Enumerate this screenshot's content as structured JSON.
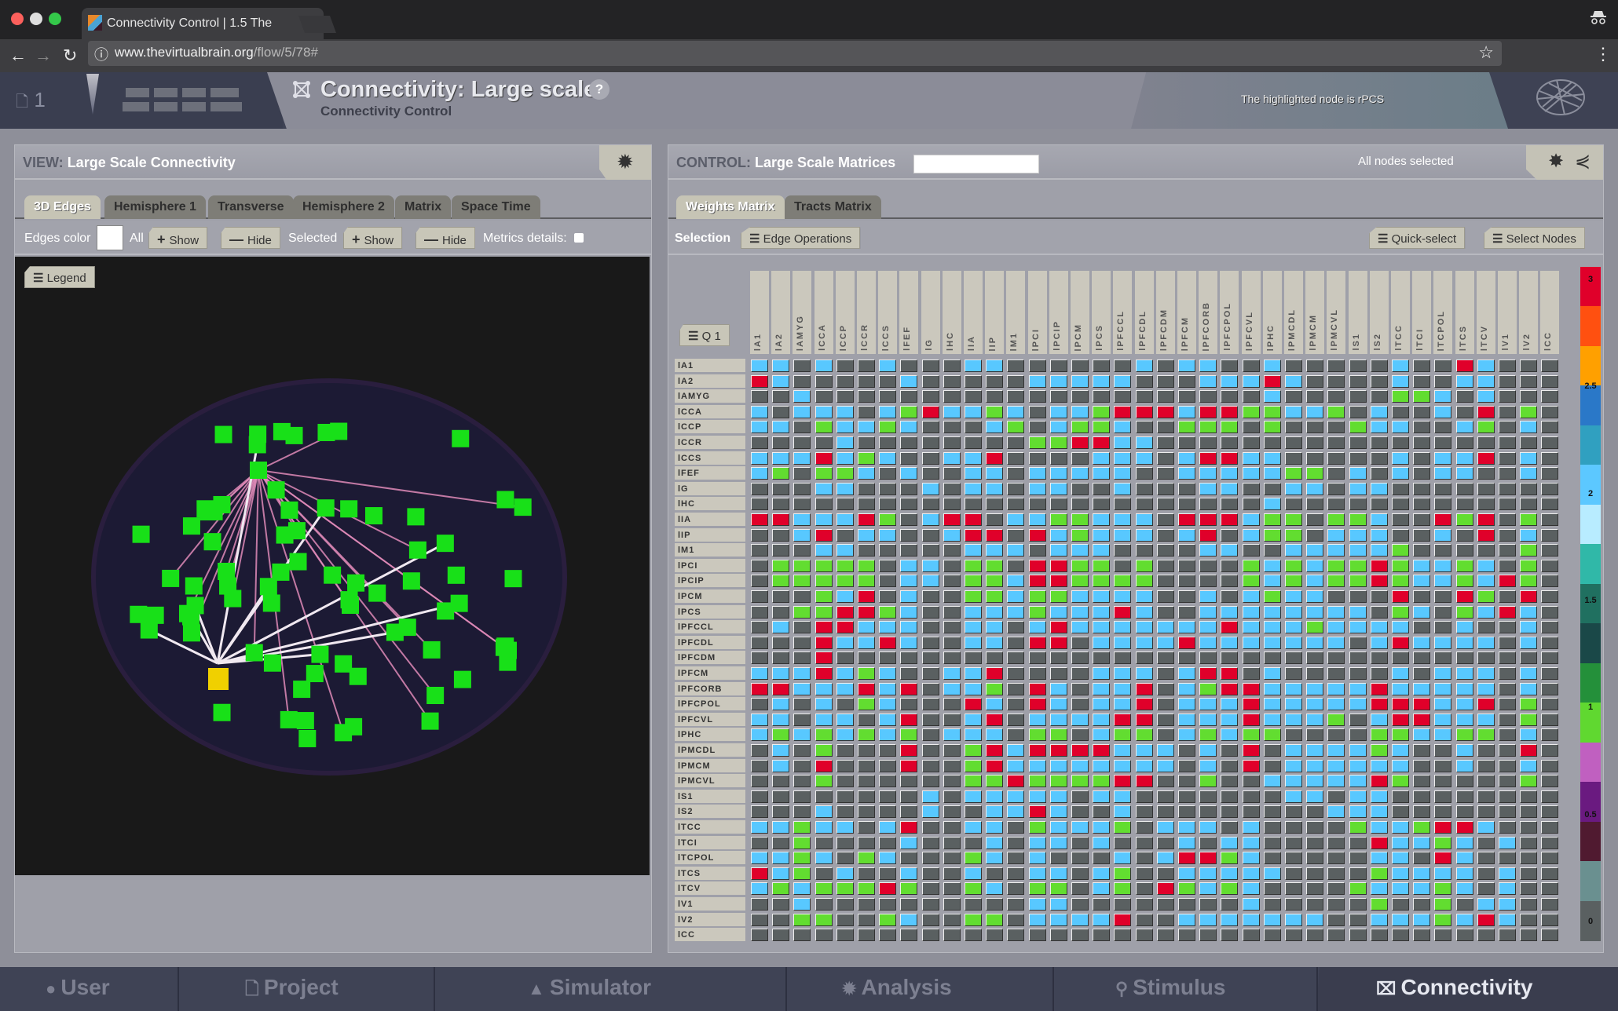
{
  "browser": {
    "tab_title": "Connectivity Control | 1.5 The",
    "tab_close": "×",
    "url_domain": "www.thevirtualbrain.org",
    "url_path": "/flow/5/78#",
    "back": "←",
    "forward": "→",
    "reload": "↻",
    "info": "ⓘ",
    "star": "☆",
    "menu": "⋮",
    "incognito": "🕶"
  },
  "header": {
    "project_count": "1",
    "title": "Connectivity: Large scale",
    "subtitle": "Connectivity Control",
    "help": "?",
    "message": "The highlighted node is rPCS"
  },
  "view_panel": {
    "title_prefix": "VIEW:",
    "title": "Large Scale Connectivity",
    "tabs": [
      "3D Edges",
      "Hemisphere 1",
      "Transverse",
      "Hemisphere 2",
      "Matrix",
      "Space Time"
    ],
    "active_tab": "3D Edges",
    "toolbar": {
      "edges_color_label": "Edges color",
      "edges_color": "#ffffff",
      "all_label": "All",
      "show": "Show",
      "hide": "Hide",
      "selected_label": "Selected",
      "metrics_label": "Metrics details:"
    },
    "legend_button": "Legend",
    "highlighted_node_color": "#f0d000",
    "node_color": "#18e018"
  },
  "control_panel": {
    "title_prefix": "CONTROL:",
    "title": "Large Scale Matrices",
    "search_value": "",
    "status": "All nodes selected",
    "tabs": [
      "Weights Matrix",
      "Tracts Matrix"
    ],
    "active_tab": "Weights Matrix",
    "selection_label": "Selection",
    "edge_operations": "Edge Operations",
    "quick_select": "Quick-select",
    "select_nodes": "Select Nodes",
    "quadrant_button": "Q 1"
  },
  "matrix": {
    "labels": [
      "lA1",
      "lA2",
      "lAMYG",
      "lCCA",
      "lCCP",
      "lCCR",
      "lCCS",
      "lFEF",
      "lG",
      "lHC",
      "lIA",
      "lIP",
      "lM1",
      "lPCI",
      "lPCIP",
      "lPCM",
      "lPCS",
      "lPFCCL",
      "lPFCDL",
      "lPFCDM",
      "lPFCM",
      "lPFCORB",
      "lPFCPOL",
      "lPFCVL",
      "lPHC",
      "lPMCDL",
      "lPMCM",
      "lPMCVL",
      "lS1",
      "lS2",
      "lTCC",
      "lTCI",
      "lTCPOL",
      "lTCS",
      "lTCV",
      "lV1",
      "lV2",
      "lCC"
    ],
    "legend": {
      "D": 0,
      "G": 1,
      "B": 2,
      "R": 3
    },
    "colors": {
      "D": "#5a6061",
      "G": "#62dd30",
      "B": "#58c8ff",
      "R": "#e0002a"
    },
    "rows": [
      "BBDBDDBDDDBBDDDDDDBDBBDDBDDDDDBDDRBDDD",
      "RBDDDDDBDDDDDBBBBBDDDBBBRBDDDDBDDBBDDD",
      "DDBDDDDDDDDDDDDDDDDDDDDDBDDDDDGGBDBDDD",
      "BDBBBDBGRBBGBDBBGRRRBRRGGBBGDBDDBDRDGD",
      "BBDGBBGBDDDBGDBGGBDDGGGDGDDDGBBDDBGDBD",
      "DDDDBDDDDDDDDGGRRBBDDDDDDDDDDDDDDDDDDD",
      "BBBRBGBDDBBRDDDDBBBDBRRBBDDDDDBDBBRDBD",
      "BGDGGBDBDDBBDBBBBBDDBBBBBGGDBDBDBBDDBD",
      "DDDBBDDDBDBBDBBDDBDDDBBDDBBDBBDDDDDDDD",
      "DDDDDDDDDDDDDDDDDDDDDDDDBDDDDDDDDDDDDD",
      "RRBBBRGDBRRDBBGGBBBDRRRBGGDGGBDDRGRDGD",
      "DDBRDBBDDBRRDRBGBBBDBRDBGGDBBBDDBDRDBD",
      "DDDBBDDDDDBBBDBBBDDDDBBDDBBBBBGDDDDDGD",
      "DGGGGGDBBDGGDRRGGDGDDDDGBGBGGRGBBGBDGD",
      "DGGGGGDBBDGGBRRGGGGDDDDGBGBGGRGBBGBRGD",
      "DDDGBRDBDDGGBGGBBBBDDBDBGBBDDDRDDRGDRD",
      "DDGGRRGBDDBBBGBBBRBDDBBBBBBBBDGBDGBRBD",
      "DBDRRBBBDDBBDBRBBBBBBBRBBBGBBBBDDBDDBD",
      "DDDRBBRBDDBBDRRDBBBBRBBBBBBBDBRBBBBDBD",
      "DDDRDDDDDDDDDDDDDDDDDDDDDDDDDDDDDDDDDD",
      "BBBRBGBDDBBRDDDDBBBDBRRDBDDDDDBDBBBDBD",
      "RRBBBRBRDBBGDRBDBBRDBGRRBBBBBRBBBBBDBD",
      "DBDBDGBDDDRBDRBDBBRDBBBRBBBBBRRRBBRDGD",
      "BBDBBDBRDDBRDBBBBRRDBBBRBBBGDBRRBBBDGD",
      "BGBGBGBGDBBBDGGDBGGDBGBGGDDDDGGBBGGDBD",
      "DBDGDDDRDDGRBRRRRBBBDBDRDBBBBGBDDBDDRD",
      "DBDRDDDRDDGRBBBBBBBBDBDRDBBBBBBDDBDDBD",
      "DDDGDDDDDDGGRGGGGRRDDGDDBBBBBRGDDDDDGD",
      "DDDDDDDDBDBBBBBDBBDDDDDDDBBDBBDDDDDDDD",
      "DDDBDDDDBDDBBRBDDBDDDDDDDDDBBBDDDDDDDD",
      "BBGBBDBRDDBBDGBBBGDBBBDBDDDDGBBGRRBD",
      "DDGDDDDBDDDBDBBDBDDDBDBBDDDDDRBBGBDBD",
      "BBGBDGBDDDGBDBDDDBDBRRGBDDDDDBBDRBDDD",
      "RBGDBDDBDDBDDBBDBGDDBBBBBDDDDGBBBBDBD",
      "BGBGGGRGDDGBDGGDBGDRGBGBDDDDGBBBGBDBD",
      "DDBDDDDDDDDDDBBDDDDDDDDBDDDDDGDDGDBBD",
      "DDGGDDGBDDGGDBBBBRDDBBBBBBBDDBBBGBRBD",
      "DDDDDDDDDDDDDDDDDDDDDDDDDDDDDDDDDDDDDD"
    ]
  },
  "colorbar": {
    "ticks": [
      "3",
      "2.5",
      "2",
      "1.5",
      "1",
      "0.5",
      "0"
    ],
    "stops": [
      "#e0002a",
      "#ff5010",
      "#ffa000",
      "#2a78c8",
      "#30a0c0",
      "#5cc8ff",
      "#b8ecff",
      "#30b8a8",
      "#207060",
      "#1a4848",
      "#24903a",
      "#60d830",
      "#c060c0",
      "#6a1a80",
      "#501a30",
      "#6a9090",
      "#5a6061"
    ]
  },
  "bottom_nav": {
    "items": [
      {
        "label": "User",
        "icon": "user-icon"
      },
      {
        "label": "Project",
        "icon": "document-icon"
      },
      {
        "label": "Simulator",
        "icon": "rocket-icon"
      },
      {
        "label": "Analysis",
        "icon": "gear-icon"
      },
      {
        "label": "Stimulus",
        "icon": "pin-icon"
      },
      {
        "label": "Connectivity",
        "icon": "connectivity-icon"
      }
    ],
    "active": "Connectivity"
  }
}
